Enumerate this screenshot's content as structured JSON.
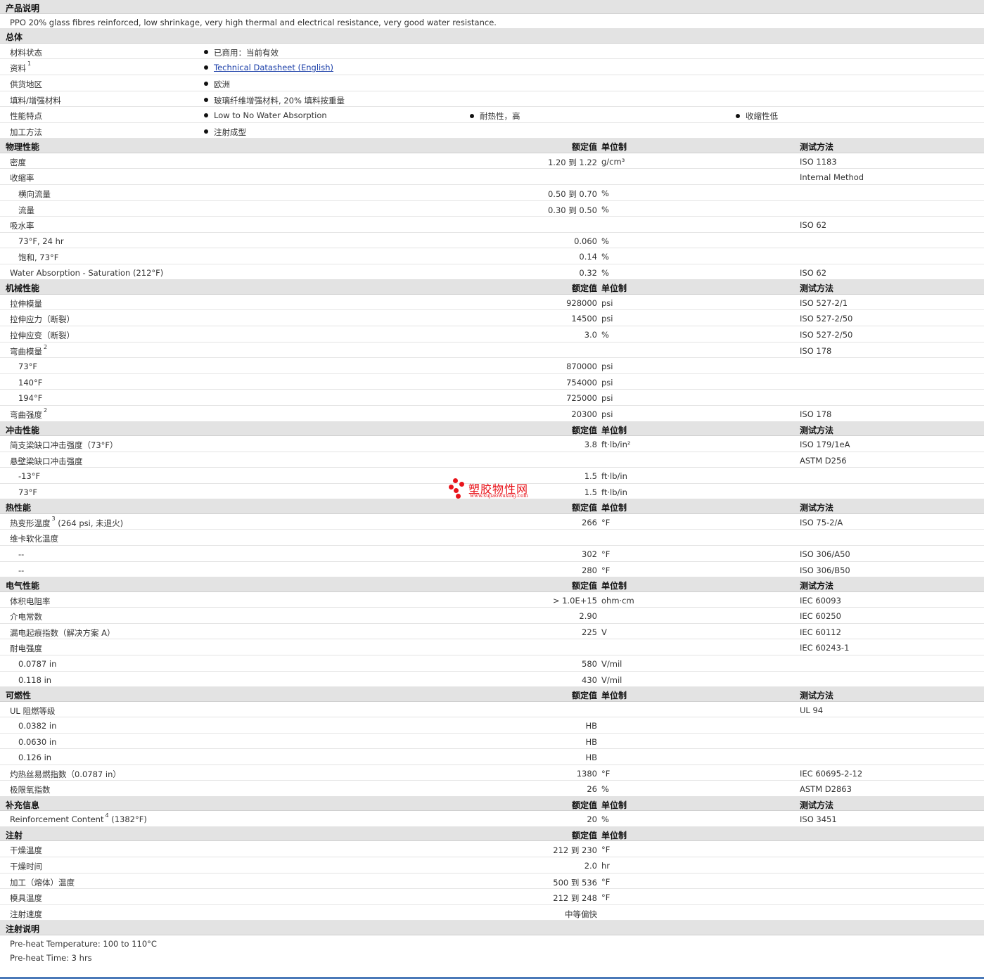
{
  "desc": {
    "title": "产品说明",
    "text": "PPO 20% glass fibres reinforced, low shrinkage, very high thermal and electrical resistance, very good water resistance."
  },
  "general": {
    "title": "总体",
    "rows": [
      {
        "label": "材料状态",
        "items": [
          "已商用：当前有效"
        ]
      },
      {
        "label": "资料",
        "sup": "1",
        "items": [
          "Technical Datasheet (English)"
        ],
        "link": true
      },
      {
        "label": "供货地区",
        "items": [
          "欧洲"
        ]
      },
      {
        "label": "填料/增强材料",
        "items": [
          "玻璃纤维增强材料, 20% 填料按重量"
        ]
      },
      {
        "label": "性能特点",
        "items": [
          "Low to No Water Absorption",
          "耐热性，高",
          "收缩性低"
        ]
      },
      {
        "label": "加工方法",
        "items": [
          "注射成型"
        ]
      }
    ]
  },
  "col_headers": {
    "value": "额定值",
    "unit": "单位制",
    "test": "测试方法"
  },
  "sections": [
    {
      "title": "物理性能",
      "rows": [
        {
          "label": "密度",
          "value": "1.20 到  1.22",
          "unit": "g/cm³",
          "test": "ISO 1183"
        },
        {
          "label": "收缩率",
          "value": "",
          "unit": "",
          "test": "Internal Method"
        },
        {
          "label": "横向流量",
          "sub": true,
          "value": "0.50 到  0.70",
          "unit": "%",
          "test": ""
        },
        {
          "label": "流量",
          "sub": true,
          "value": "0.30 到  0.50",
          "unit": "%",
          "test": ""
        },
        {
          "label": "吸水率",
          "value": "",
          "unit": "",
          "test": "ISO 62"
        },
        {
          "label": "73°F, 24 hr",
          "sub": true,
          "value": "0.060",
          "unit": "%",
          "test": ""
        },
        {
          "label": "饱和, 73°F",
          "sub": true,
          "value": "0.14",
          "unit": "%",
          "test": ""
        },
        {
          "label": "Water Absorption - Saturation (212°F)",
          "value": "0.32",
          "unit": "%",
          "test": "ISO 62"
        }
      ]
    },
    {
      "title": "机械性能",
      "rows": [
        {
          "label": "拉伸模量",
          "value": "928000",
          "unit": "psi",
          "test": "ISO 527-2/1"
        },
        {
          "label": "拉伸应力（断裂）",
          "value": "14500",
          "unit": "psi",
          "test": "ISO 527-2/50"
        },
        {
          "label": "拉伸应变（断裂）",
          "value": "3.0",
          "unit": "%",
          "test": "ISO 527-2/50"
        },
        {
          "label": "弯曲模量",
          "sup": "2",
          "value": "",
          "unit": "",
          "test": "ISO 178"
        },
        {
          "label": "73°F",
          "sub": true,
          "value": "870000",
          "unit": "psi",
          "test": ""
        },
        {
          "label": "140°F",
          "sub": true,
          "value": "754000",
          "unit": "psi",
          "test": ""
        },
        {
          "label": "194°F",
          "sub": true,
          "value": "725000",
          "unit": "psi",
          "test": ""
        },
        {
          "label": "弯曲强度",
          "sup": "2",
          "value": "20300",
          "unit": "psi",
          "test": "ISO 178"
        }
      ]
    },
    {
      "title": "冲击性能",
      "rows": [
        {
          "label": "简支梁缺口冲击强度（73°F）",
          "value": "3.8",
          "unit": "ft·lb/in²",
          "test": "ISO 179/1eA"
        },
        {
          "label": "悬壁梁缺口冲击强度",
          "value": "",
          "unit": "",
          "test": "ASTM D256"
        },
        {
          "label": "-13°F",
          "sub": true,
          "value": "1.5",
          "unit": "ft·lb/in",
          "test": ""
        },
        {
          "label": "73°F",
          "sub": true,
          "value": "1.5",
          "unit": "ft·lb/in",
          "test": ""
        }
      ]
    },
    {
      "title": "热性能",
      "rows": [
        {
          "label": "热变形温度",
          "sup": "3",
          "suffix": " (264 psi, 未退火)",
          "value": "266",
          "unit": "°F",
          "test": "ISO 75-2/A"
        },
        {
          "label": "维卡软化温度",
          "value": "",
          "unit": "",
          "test": ""
        },
        {
          "label": "--",
          "sub": true,
          "value": "302",
          "unit": "°F",
          "test": "ISO 306/A50"
        },
        {
          "label": "--",
          "sub": true,
          "value": "280",
          "unit": "°F",
          "test": "ISO 306/B50"
        }
      ]
    },
    {
      "title": "电气性能",
      "rows": [
        {
          "label": "体积电阻率",
          "value": "> 1.0E+15",
          "unit": "ohm·cm",
          "test": "IEC 60093"
        },
        {
          "label": "介电常数",
          "value": "2.90",
          "unit": "",
          "test": "IEC 60250"
        },
        {
          "label": "漏电起痕指数（解决方案  A）",
          "value": "225",
          "unit": "V",
          "test": "IEC 60112"
        },
        {
          "label": "耐电强度",
          "value": "",
          "unit": "",
          "test": "IEC 60243-1"
        },
        {
          "label": "0.0787 in",
          "sub": true,
          "value": "580",
          "unit": "V/mil",
          "test": ""
        },
        {
          "label": "0.118 in",
          "sub": true,
          "value": "430",
          "unit": "V/mil",
          "test": ""
        }
      ]
    },
    {
      "title": "可燃性",
      "rows": [
        {
          "label": "UL 阻燃等级",
          "value": "",
          "unit": "",
          "test": "UL 94"
        },
        {
          "label": "0.0382 in",
          "sub": true,
          "value": "HB",
          "unit": "",
          "test": ""
        },
        {
          "label": "0.0630 in",
          "sub": true,
          "value": "HB",
          "unit": "",
          "test": ""
        },
        {
          "label": "0.126 in",
          "sub": true,
          "value": "HB",
          "unit": "",
          "test": ""
        },
        {
          "label": "灼热丝易燃指数（0.0787 in）",
          "value": "1380",
          "unit": "°F",
          "test": "IEC 60695-2-12"
        },
        {
          "label": "极限氧指数",
          "value": "26",
          "unit": "%",
          "test": "ASTM D2863"
        }
      ]
    },
    {
      "title": "补充信息",
      "rows": [
        {
          "label": "Reinforcement Content",
          "sup": "4",
          "suffix": " (1382°F)",
          "value": "20",
          "unit": "%",
          "test": "ISO 3451"
        }
      ]
    },
    {
      "title": "注射",
      "no_test": true,
      "rows": [
        {
          "label": "干燥温度",
          "value": "212 到  230",
          "unit": "°F",
          "test": ""
        },
        {
          "label": "干燥时间",
          "value": "2.0",
          "unit": "hr",
          "test": ""
        },
        {
          "label": "加工（熔体）温度",
          "value": "500 到  536",
          "unit": "°F",
          "test": ""
        },
        {
          "label": "模具温度",
          "value": "212 到  248",
          "unit": "°F",
          "test": ""
        },
        {
          "label": "注射速度",
          "value": "中等偏快",
          "unit": "",
          "test": ""
        }
      ]
    }
  ],
  "notes": {
    "title": "注射说明",
    "lines": [
      "Pre-heat Temperature: 100 to 110°C",
      "Pre-heat Time: 3 hrs"
    ]
  },
  "watermark": {
    "name": "塑胶物性网",
    "url": "www.sujiaowuxing.com",
    "color": "#e8141b"
  }
}
